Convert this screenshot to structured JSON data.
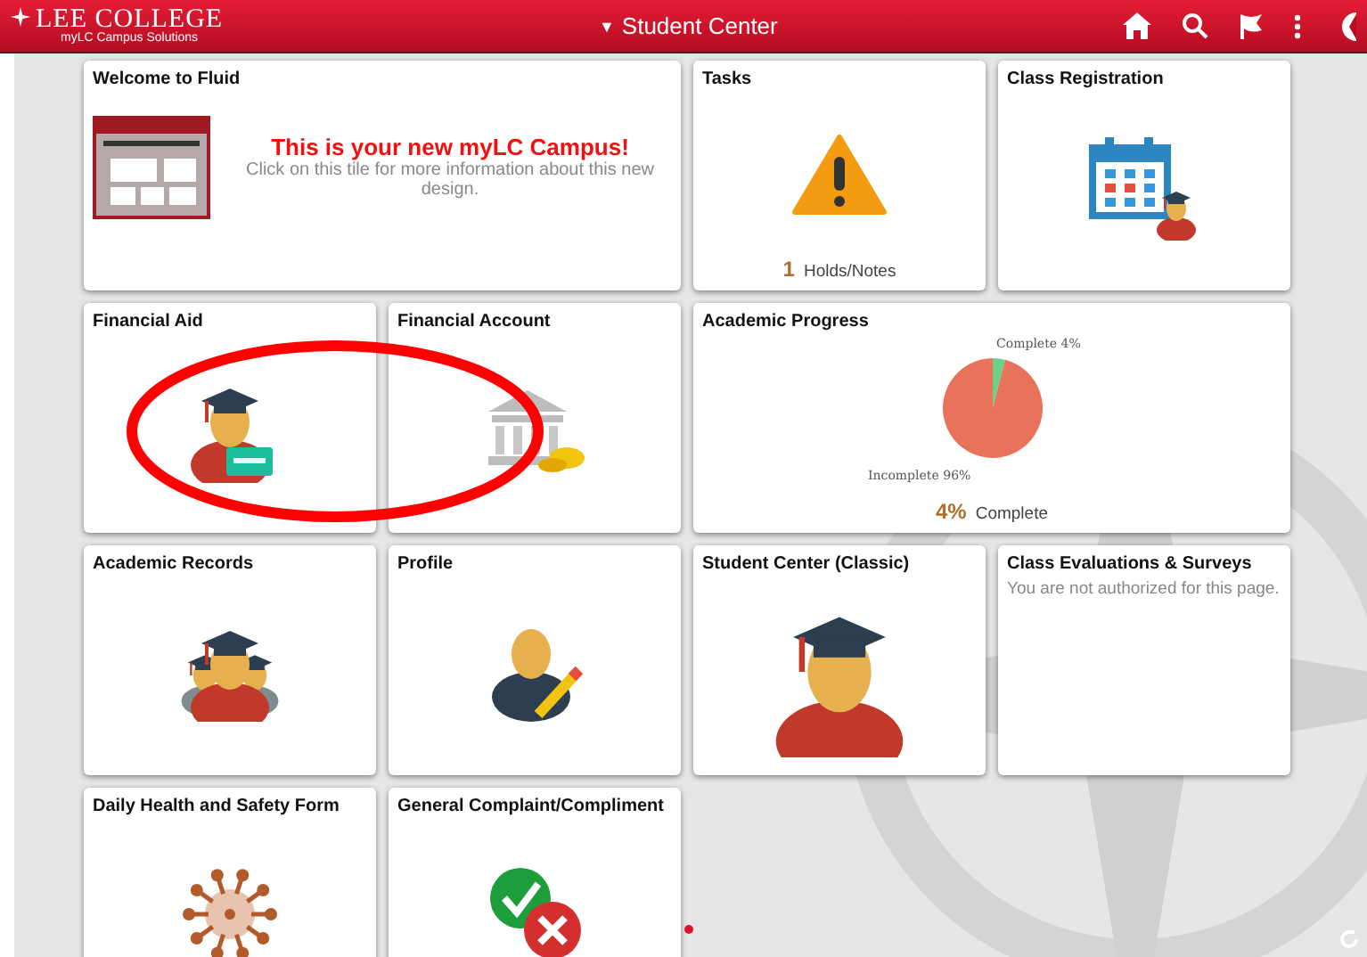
{
  "header": {
    "logo_title": "LEE COLLEGE",
    "logo_subtitle": "myLC Campus Solutions",
    "caret": "▼",
    "title": "Student Center"
  },
  "tiles": [
    {
      "kind": "welcome",
      "title": "Welcome to Fluid",
      "headline": "This is your new myLC Campus!",
      "body": "Click on this tile for more information about this new design."
    },
    {
      "kind": "count",
      "title": "Tasks",
      "count": "1",
      "count_label": "Holds/Notes"
    },
    {
      "kind": "icon",
      "title": "Class Registration"
    },
    {
      "kind": "icon",
      "title": "Financial Aid"
    },
    {
      "kind": "icon",
      "title": "Financial Account"
    },
    {
      "kind": "chart",
      "title": "Academic Progress",
      "percent": "4%",
      "percent_label": "Complete",
      "chart_data": {
        "type": "pie",
        "categories": [
          "Complete",
          "Incomplete"
        ],
        "values": [
          4,
          96
        ],
        "colors": [
          "#6ccf8a",
          "#e8725a"
        ],
        "value_labels": [
          "4%",
          "96%"
        ]
      }
    },
    {
      "kind": "icon",
      "title": "Academic Records"
    },
    {
      "kind": "icon",
      "title": "Profile"
    },
    {
      "kind": "icon",
      "title": "Student Center (Classic)"
    },
    {
      "kind": "message",
      "title": "Class Evaluations & Surveys",
      "message": "You are not authorized for this page."
    },
    {
      "kind": "icon",
      "title": "Daily Health and Safety Form"
    },
    {
      "kind": "icon",
      "title": "General Complaint/Compliment"
    }
  ]
}
